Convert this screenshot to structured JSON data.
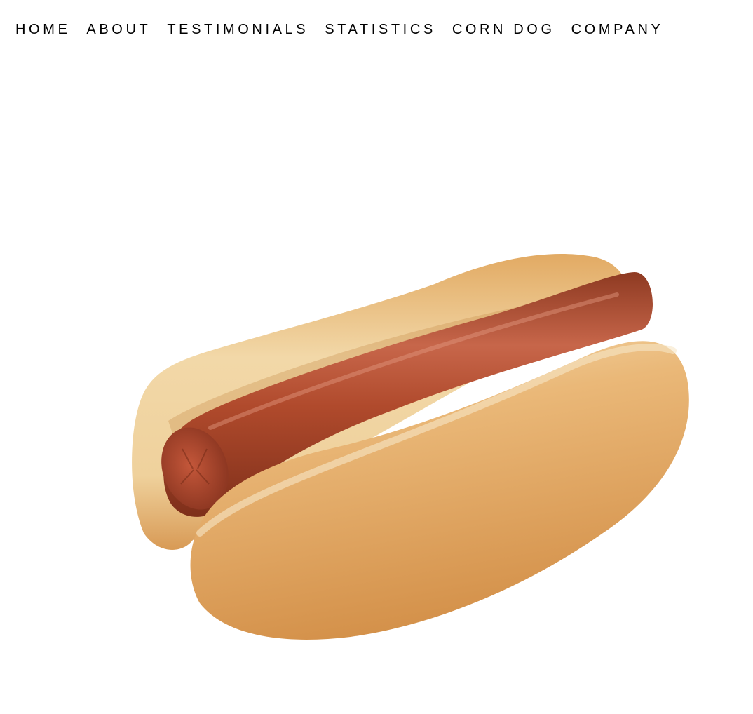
{
  "nav": {
    "items": [
      {
        "label": "HOME"
      },
      {
        "label": "ABOUT"
      },
      {
        "label": "TESTIMONIALS"
      },
      {
        "label": "STATISTICS"
      },
      {
        "label": "CORN DOG"
      },
      {
        "label": "COMPANY"
      }
    ]
  },
  "hero": {
    "image_name": "hot-dog-in-bun"
  },
  "colors": {
    "background": "#ffffff",
    "nav_text": "#000000",
    "bun": "#e8a75a",
    "sausage": "#b24a2b"
  }
}
